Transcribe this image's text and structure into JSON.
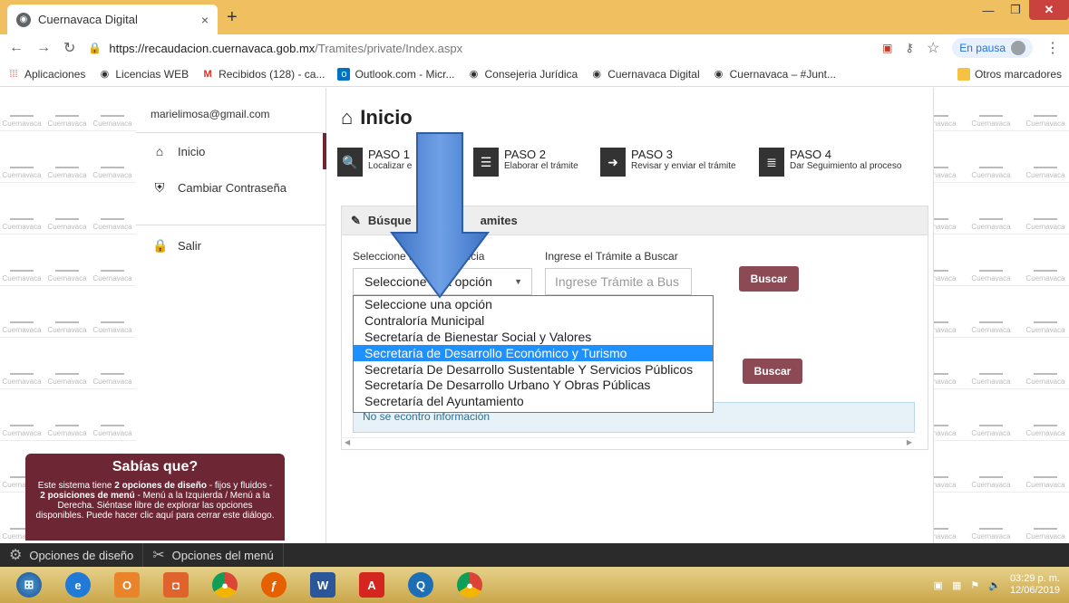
{
  "browser": {
    "tab_title": "Cuernavaca Digital",
    "tab_close": "×",
    "new_tab": "+",
    "url_host": "https://recaudacion.cuernavaca.gob.mx",
    "url_path": "/Tramites/private/Index.aspx",
    "profile_label": "En pausa",
    "bookmarks": [
      "Aplicaciones",
      "Licencias WEB",
      "Recibidos (128) - ca...",
      "Outlook.com - Micr...",
      "Consejeria Jurídica",
      "Cuernavaca Digital",
      "Cuernavaca – #Junt..."
    ],
    "other_bookmarks": "Otros marcadores"
  },
  "watermark": "Cuernavaca",
  "sidebar": {
    "user_email": "marielimosa@gmail.com",
    "items": [
      {
        "label": "Inicio"
      },
      {
        "label": "Cambiar Contraseña"
      },
      {
        "label": "Salir"
      }
    ]
  },
  "main": {
    "title": "Inicio",
    "steps": [
      {
        "label": "PASO 1",
        "desc": "Localizar e"
      },
      {
        "label": "PASO 2",
        "desc": "Elaborar el trámite"
      },
      {
        "label": "PASO 3",
        "desc": "Revisar y enviar el trámite"
      },
      {
        "label": "PASO 4",
        "desc": "Dar Seguimiento al proceso"
      }
    ],
    "panel_title": "Búsque",
    "panel_title_tail": "amites",
    "dependencia_label": "Seleccione la Dependencia",
    "tramite_label": "Ingrese el Trámite a Buscar",
    "select_value": "Seleccione una opción",
    "tramite_placeholder": "Ingrese Trámite a Bus",
    "search_button": "Buscar",
    "search_button_2": "Buscar",
    "no_info": "No se econtro información"
  },
  "dropdown": {
    "options": [
      "Seleccione una opción",
      "Contraloría Municipal",
      "Secretaría de Bienestar Social y Valores",
      "Secretaría de Desarrollo Económico y Turismo",
      "Secretaría De Desarrollo Sustentable Y Servicios Públicos",
      "Secretaría De Desarrollo Urbano Y Obras Públicas",
      "Secretaría del Ayuntamiento"
    ],
    "highlighted_index": 3
  },
  "tip": {
    "title": "Sabías que?",
    "body_1": "Este sistema tiene ",
    "body_b1": "2 opciones de diseño",
    "body_2": " - fijos y fluidos - ",
    "body_b2": "2 posiciones de menú",
    "body_3": " - Menú a la Izquierda / Menú a la Derecha. Siéntase libre de explorar las opciones disponibles. Puede hacer clic aquí para cerrar este diálogo."
  },
  "options_bar": {
    "design": "Opciones de diseño",
    "menu": "Opciones del menú"
  },
  "taskbar": {
    "time": "03:29 p. m.",
    "date": "12/06/2019"
  },
  "colors": {
    "accent": "#6d2633",
    "button": "#8c4a55",
    "highlight": "#1e90ff",
    "tabbar": "#f0c060"
  }
}
